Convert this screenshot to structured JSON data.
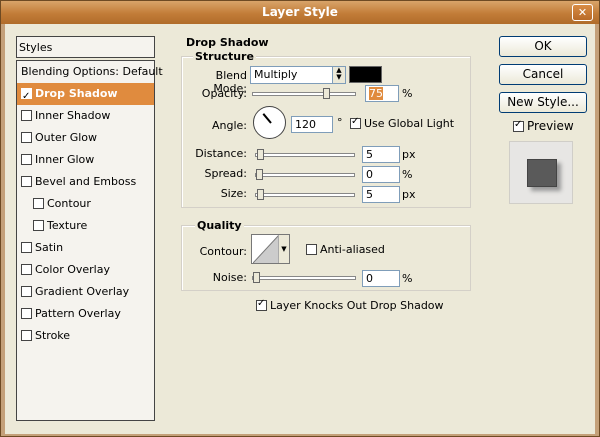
{
  "window": {
    "title": "Layer Style",
    "close_glyph": "✕"
  },
  "sidebar": {
    "header": "Styles",
    "items": [
      {
        "label": "Blending Options: Default",
        "checkbox": false,
        "checked": false,
        "selected": false,
        "indent": false
      },
      {
        "label": "Drop Shadow",
        "checkbox": true,
        "checked": true,
        "selected": true,
        "indent": false
      },
      {
        "label": "Inner Shadow",
        "checkbox": true,
        "checked": false,
        "selected": false,
        "indent": false
      },
      {
        "label": "Outer Glow",
        "checkbox": true,
        "checked": false,
        "selected": false,
        "indent": false
      },
      {
        "label": "Inner Glow",
        "checkbox": true,
        "checked": false,
        "selected": false,
        "indent": false
      },
      {
        "label": "Bevel and Emboss",
        "checkbox": true,
        "checked": false,
        "selected": false,
        "indent": false
      },
      {
        "label": "Contour",
        "checkbox": true,
        "checked": false,
        "selected": false,
        "indent": true
      },
      {
        "label": "Texture",
        "checkbox": true,
        "checked": false,
        "selected": false,
        "indent": true
      },
      {
        "label": "Satin",
        "checkbox": true,
        "checked": false,
        "selected": false,
        "indent": false
      },
      {
        "label": "Color Overlay",
        "checkbox": true,
        "checked": false,
        "selected": false,
        "indent": false
      },
      {
        "label": "Gradient Overlay",
        "checkbox": true,
        "checked": false,
        "selected": false,
        "indent": false
      },
      {
        "label": "Pattern Overlay",
        "checkbox": true,
        "checked": false,
        "selected": false,
        "indent": false
      },
      {
        "label": "Stroke",
        "checkbox": true,
        "checked": false,
        "selected": false,
        "indent": false
      }
    ]
  },
  "drop_shadow": {
    "title": "Drop Shadow",
    "structure": {
      "title": "Structure",
      "blend_mode_label": "Blend Mode:",
      "blend_mode_value": "Multiply",
      "shadow_color": "#000000",
      "opacity_label": "Opacity:",
      "opacity_value": "75",
      "opacity_fraction": 0.75,
      "opacity_unit": "%",
      "angle_label": "Angle:",
      "angle_value": "120",
      "angle_unit": "°",
      "use_global_light_label": "Use Global Light",
      "use_global_light_checked": true,
      "distance_label": "Distance:",
      "distance_value": "5",
      "distance_unit": "px",
      "spread_label": "Spread:",
      "spread_value": "0",
      "spread_unit": "%",
      "size_label": "Size:",
      "size_value": "5",
      "size_unit": "px"
    },
    "quality": {
      "title": "Quality",
      "contour_label": "Contour:",
      "anti_aliased_label": "Anti-aliased",
      "anti_aliased_checked": false,
      "noise_label": "Noise:",
      "noise_value": "0",
      "noise_unit": "%"
    },
    "knocks_out_label": "Layer Knocks Out Drop Shadow",
    "knocks_out_checked": true
  },
  "buttons": {
    "ok": "OK",
    "cancel": "Cancel",
    "new_style": "New Style..."
  },
  "preview": {
    "label": "Preview",
    "checked": true
  }
}
